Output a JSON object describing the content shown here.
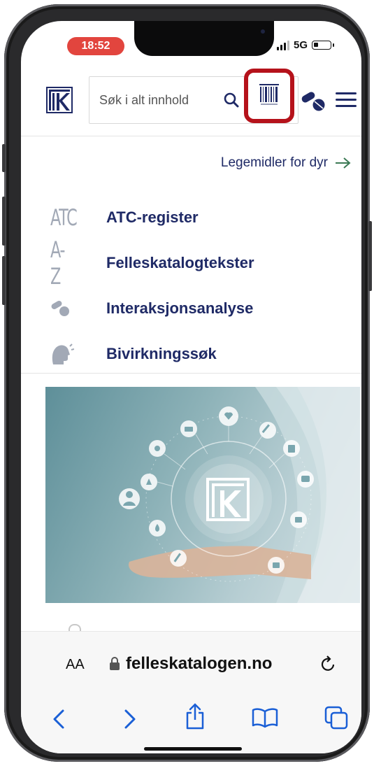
{
  "status_bar": {
    "time": "18:52",
    "network": "5G"
  },
  "header": {
    "search_placeholder": "Søk i alt innhold",
    "icons": [
      "logo-icon",
      "search-icon",
      "barcode-icon",
      "pills-icon",
      "menu-icon"
    ]
  },
  "vet_link": {
    "label": "Legemidler for dyr",
    "icon": "arrow-right-icon"
  },
  "nav_items": [
    {
      "label": "ATC-register",
      "icon_text": "ATC"
    },
    {
      "label": "Felleskatalogtekster",
      "icon_text": "A-Z"
    },
    {
      "label": "Interaksjonsanalyse",
      "icon": "pills-icon"
    },
    {
      "label": "Bivirkningssøk",
      "icon": "head-icon"
    }
  ],
  "browser": {
    "aa_label": "AA",
    "url": "felleskatalogen.no",
    "toolbar": [
      "back-icon",
      "forward-icon",
      "share-icon",
      "bookmarks-icon",
      "tabs-icon"
    ]
  },
  "colors": {
    "brand_navy": "#1f2a66",
    "highlight_red": "#b5121b",
    "time_pill": "#e2453e",
    "link_arrow": "#3c7a55",
    "ios_blue": "#1a5fd6"
  }
}
